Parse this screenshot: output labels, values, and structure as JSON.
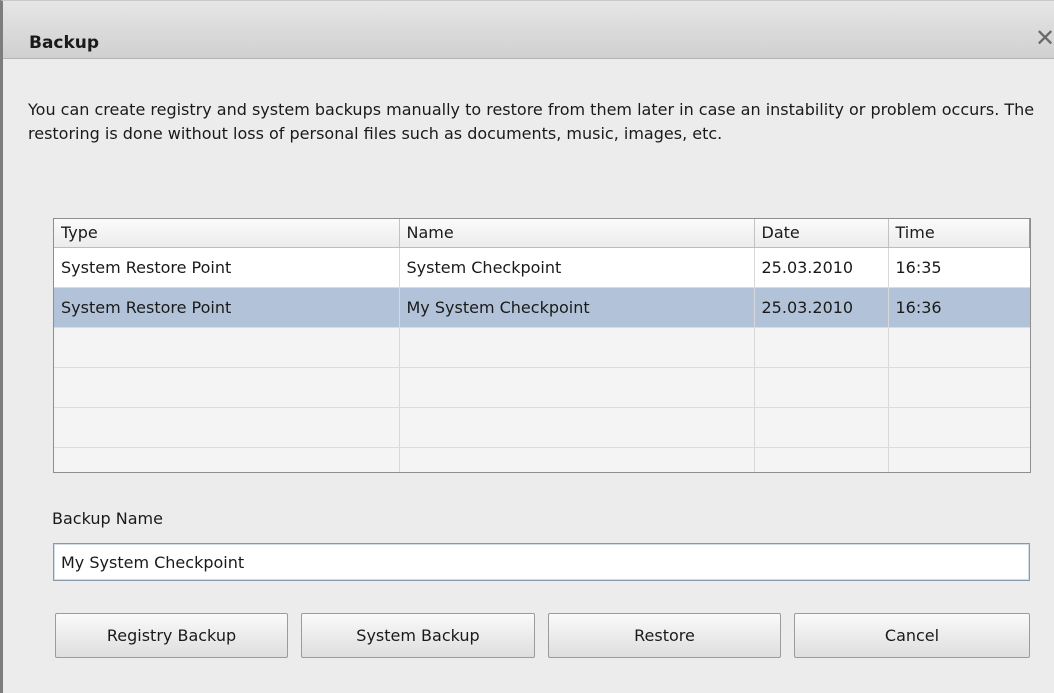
{
  "window": {
    "title": "Backup",
    "close_glyph": "✕"
  },
  "description": "You can create registry and system backups manually to restore from them later in case an instability or problem occurs. The restoring is done without loss of personal files such as documents, music, images, etc.",
  "table": {
    "columns": [
      "Type",
      "Name",
      "Date",
      "Time"
    ],
    "rows": [
      {
        "type": "System Restore Point",
        "name": "System Checkpoint",
        "date": "25.03.2010",
        "time": "16:35",
        "selected": false
      },
      {
        "type": "System Restore Point",
        "name": "My System Checkpoint",
        "date": "25.03.2010",
        "time": "16:36",
        "selected": true
      }
    ],
    "selected_color": "#b2c3d9"
  },
  "backup_name": {
    "label": "Backup Name",
    "value": "My System Checkpoint",
    "placeholder": ""
  },
  "buttons": {
    "registry_backup": "Registry Backup",
    "system_backup": "System Backup",
    "restore": "Restore",
    "cancel": "Cancel"
  },
  "icons": {
    "close": "close-icon"
  }
}
